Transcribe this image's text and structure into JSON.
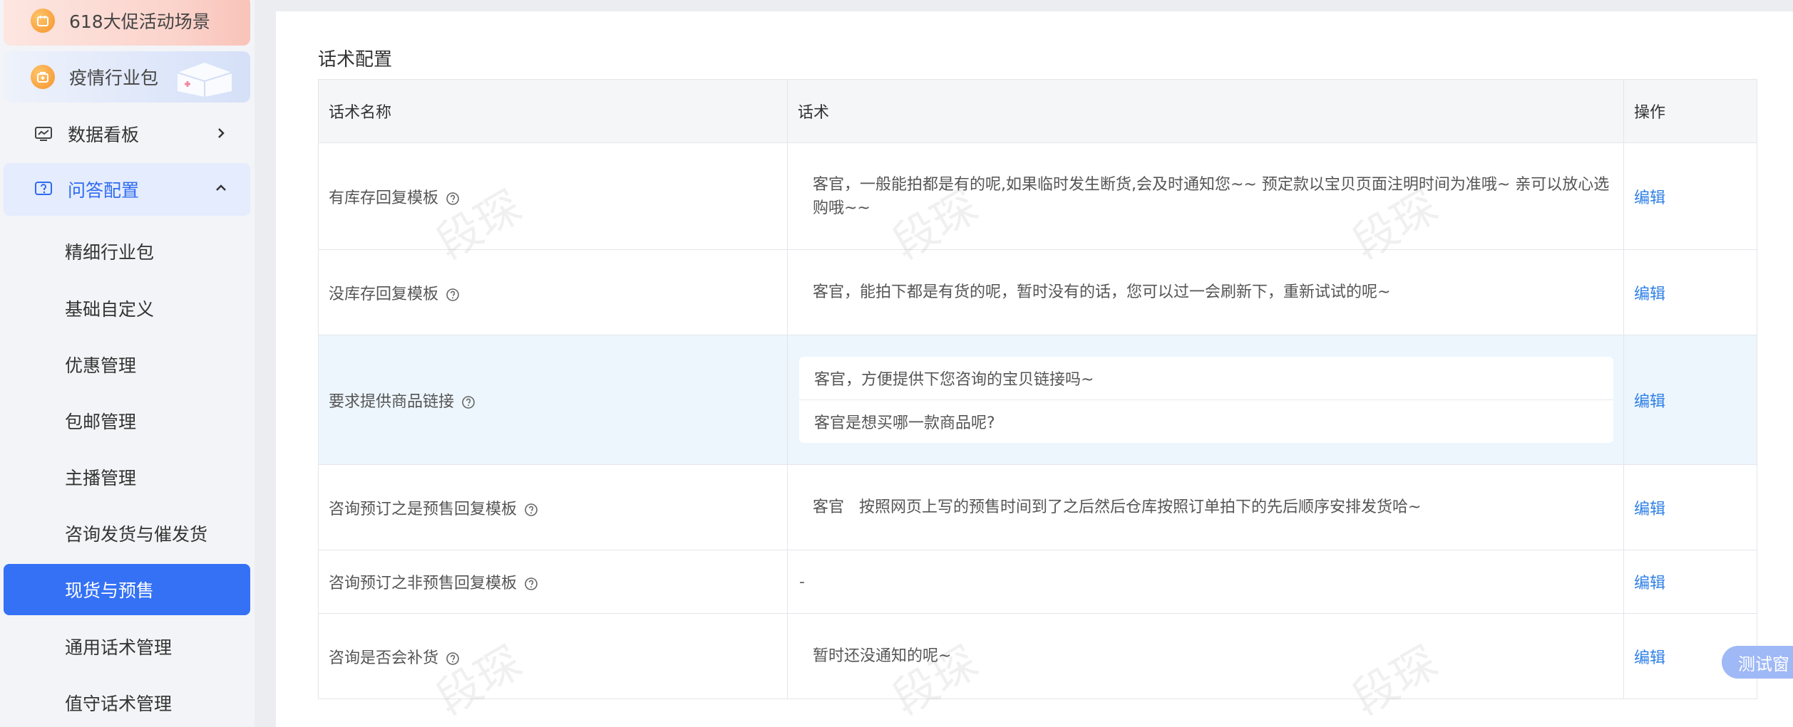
{
  "sidebar": {
    "promo_618": {
      "label": "618大促活动场景"
    },
    "promo_epidemic": {
      "label": "疫情行业包"
    },
    "dashboard": {
      "label": "数据看板"
    },
    "qa_config": {
      "label": "问答配置"
    },
    "sub_items": [
      {
        "label": "精细行业包"
      },
      {
        "label": "基础自定义"
      },
      {
        "label": "优惠管理"
      },
      {
        "label": "包邮管理"
      },
      {
        "label": "主播管理"
      },
      {
        "label": "咨询发货与催发货"
      },
      {
        "label": "现货与预售",
        "active": true
      },
      {
        "label": "通用话术管理"
      },
      {
        "label": "值守话术管理"
      }
    ]
  },
  "main": {
    "section_title": "话术配置",
    "table": {
      "headers": {
        "name": "话术名称",
        "script": "话术",
        "action": "操作"
      },
      "rows": [
        {
          "name": "有库存回复模板",
          "scripts": [
            "客官，一般能拍都是有的呢,如果临时发生断货,会及时通知您~~  预定款以宝贝页面注明时间为准哦~  亲可以放心选购哦~~"
          ],
          "action": "编辑"
        },
        {
          "name": "没库存回复模板",
          "scripts": [
            "客官，能拍下都是有货的呢，暂时没有的话，您可以过一会刷新下，重新试试的呢~"
          ],
          "action": "编辑"
        },
        {
          "name": "要求提供商品链接",
          "scripts": [
            "客官，方便提供下您咨询的宝贝链接吗~",
            "客官是想买哪一款商品呢?"
          ],
          "action": "编辑"
        },
        {
          "name": "咨询预订之是预售回复模板",
          "scripts": [
            "客官   按照网页上写的预售时间到了之后然后仓库按照订单拍下的先后顺序安排发货哈~"
          ],
          "action": "编辑"
        },
        {
          "name": "咨询预订之非预售回复模板",
          "scripts": [
            "-"
          ],
          "action": "编辑"
        },
        {
          "name": "咨询是否会补货",
          "scripts": [
            "暂时还没通知的呢~"
          ],
          "action": "编辑"
        }
      ]
    }
  },
  "watermark": "段琛",
  "floating": {
    "test_window": "测试窗"
  },
  "colors": {
    "accent": "#3471f5",
    "link": "#2f80e6",
    "highlight_row": "#edf6fd"
  }
}
